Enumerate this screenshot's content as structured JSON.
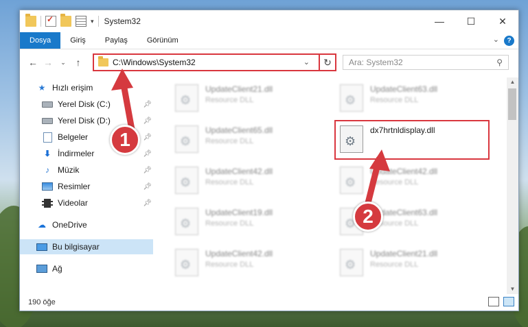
{
  "window": {
    "title": "System32"
  },
  "ribbon": {
    "tabs": [
      "Dosya",
      "Giriş",
      "Paylaş",
      "Görünüm"
    ],
    "help": "?"
  },
  "nav": {
    "address": "C:\\Windows\\System32",
    "search_placeholder": "Ara: System32"
  },
  "sidebar": {
    "items": [
      {
        "label": "Hızlı erişim",
        "icon": "star-icon",
        "pinned": false
      },
      {
        "label": "Yerel Disk (C:)",
        "icon": "drive-icon",
        "pinned": true
      },
      {
        "label": "Yerel Disk (D:)",
        "icon": "drive-icon",
        "pinned": true
      },
      {
        "label": "Belgeler",
        "icon": "document-icon",
        "pinned": true
      },
      {
        "label": "İndirmeler",
        "icon": "download-icon",
        "pinned": true
      },
      {
        "label": "Müzik",
        "icon": "music-icon",
        "pinned": true
      },
      {
        "label": "Resimler",
        "icon": "pictures-icon",
        "pinned": true
      },
      {
        "label": "Videolar",
        "icon": "videos-icon",
        "pinned": true
      },
      {
        "label": "OneDrive",
        "icon": "cloud-icon",
        "pinned": false
      },
      {
        "label": "Bu bilgisayar",
        "icon": "computer-icon",
        "pinned": false
      },
      {
        "label": "Ağ",
        "icon": "network-icon",
        "pinned": false
      }
    ]
  },
  "files": {
    "left_column": [
      {
        "name": "UpdateClient21.dll",
        "type": "Resource DLL"
      },
      {
        "name": "UpdateClient65.dll",
        "type": "Resource DLL"
      },
      {
        "name": "UpdateClient42.dll",
        "type": "Resource DLL"
      },
      {
        "name": "UpdateClient19.dll",
        "type": "Resource DLL"
      },
      {
        "name": "UpdateClient42.dll",
        "type": "Resource DLL"
      }
    ],
    "right_column": [
      {
        "name": "UpdateClient63.dll",
        "type": "Resource DLL"
      },
      {
        "name": "dx7hrtnldisplay.dll",
        "type": ""
      },
      {
        "name": "UpdateClient42.dll",
        "type": "Resource DLL"
      },
      {
        "name": "UpdateClient63.dll",
        "type": "Resource DLL"
      },
      {
        "name": "UpdateClient21.dll",
        "type": "Resource DLL"
      }
    ]
  },
  "status": {
    "item_count": "190 öğe"
  },
  "annotations": {
    "marker1": "1",
    "marker2": "2",
    "color": "#d53a3f"
  }
}
